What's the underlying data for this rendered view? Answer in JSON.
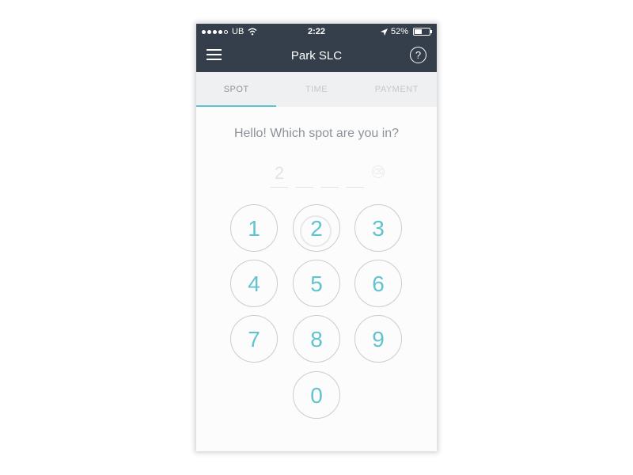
{
  "status_bar": {
    "carrier": "UB",
    "time": "2:22",
    "battery_text": "52%",
    "battery_level": 0.52,
    "signal_icon": "signal-dots-icon",
    "wifi_icon": "wifi-icon",
    "location_icon": "location-arrow-icon",
    "battery_icon": "battery-icon"
  },
  "nav": {
    "title": "Park SLC",
    "menu_icon": "hamburger-menu-icon",
    "help_icon": "help-icon",
    "help_glyph": "?"
  },
  "tabs": [
    {
      "label": "SPOT",
      "active": true
    },
    {
      "label": "TIME",
      "active": false
    },
    {
      "label": "PAYMENT",
      "active": false
    }
  ],
  "prompt": "Hello! Which spot are you in?",
  "spot_code": {
    "digits": [
      "2",
      "",
      "",
      ""
    ],
    "backspace_glyph": "⌫"
  },
  "keypad": {
    "keys": [
      "1",
      "2",
      "3",
      "4",
      "5",
      "6",
      "7",
      "8",
      "9",
      "0"
    ],
    "pressed_key": "2"
  },
  "colors": {
    "header": "#353f4b",
    "accent": "#5ec3cf",
    "tab_bg": "#eef0f2",
    "text_muted": "#8b939b"
  }
}
